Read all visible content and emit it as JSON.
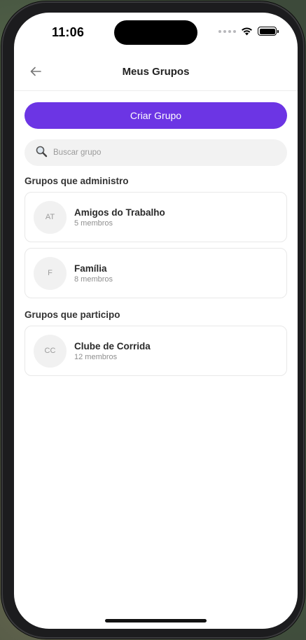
{
  "status_bar": {
    "time": "11:06"
  },
  "header": {
    "title": "Meus Grupos",
    "back_icon": "arrow-left-icon"
  },
  "actions": {
    "create_group_label": "Criar Grupo"
  },
  "search": {
    "placeholder": "Buscar grupo",
    "value": "",
    "icon": "search-icon"
  },
  "sections": {
    "admin": {
      "title": "Grupos que administro",
      "groups": [
        {
          "initials": "AT",
          "name": "Amigos do Trabalho",
          "members": "5 membros"
        },
        {
          "initials": "F",
          "name": "Família",
          "members": "8 membros"
        }
      ]
    },
    "participant": {
      "title": "Grupos que participo",
      "groups": [
        {
          "initials": "CC",
          "name": "Clube de Corrida",
          "members": "12 membros"
        }
      ]
    }
  },
  "colors": {
    "accent": "#6c35e4",
    "background": "#ffffff",
    "card_border": "#e8e8e8",
    "avatar_bg": "#f1f1f1",
    "search_bg": "#f2f2f2"
  }
}
